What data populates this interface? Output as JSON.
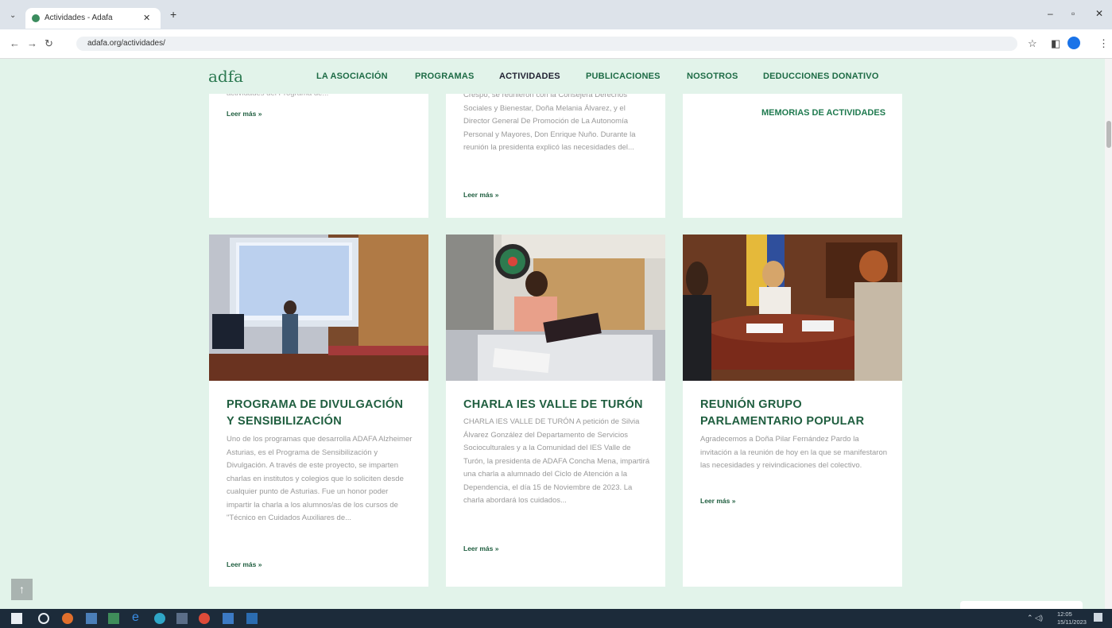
{
  "browser": {
    "tab_title": "Actividades - Adafa",
    "tab_close": "✕",
    "new_tab": "+",
    "url": "adafa.org/actividades/",
    "window_controls": [
      "–",
      "▫",
      "✕"
    ]
  },
  "site": {
    "logo": "adfa",
    "menu": [
      {
        "label": "LA ASOCIACIÓN"
      },
      {
        "label": "PROGRAMAS"
      },
      {
        "label": "ACTIVIDADES"
      },
      {
        "label": "PUBLICACIONES"
      },
      {
        "label": "NOSOTROS"
      },
      {
        "label": "DEDUCCIONES DONATIVO"
      }
    ],
    "active_menu": "ACTIVIDADES",
    "memorias_link": "MEMORIAS DE ACTIVIDADES"
  },
  "top_cards": [
    {
      "desc": "actividades del Programa de...",
      "more": "Leer más »"
    },
    {
      "desc": "Crespo, se reunieron con la Consejera Derechos Sociales y Bienestar, Doña Melania Álvarez, y el Director General De Promoción de La Autonomía Personal y Mayores, Don Enrique Nuño. Durante la reunión la presidenta explicó las necesidades del...",
      "more": "Leer más »"
    }
  ],
  "cards": [
    {
      "title_lines": [
        "PROGRAMA DE DIVULGACIÓN",
        "Y SENSIBILIZACIÓN"
      ],
      "desc": "Uno de los programas que desarrolla ADAFA Alzheimer Asturias, es el Programa de Sensibilización y Divulgación. A través de este proyecto, se imparten charlas en institutos y colegios que lo soliciten desde cualquier punto de Asturias. Fue un honor poder impartir la charla a los alumnos/as de los cursos de \"Técnico en Cuidados Auxiliares de...",
      "more": "Leer más »"
    },
    {
      "title_lines": [
        "CHARLA IES VALLE DE TURÓN"
      ],
      "desc": "CHARLA IES VALLE DE TURÓN A petición de Silvia Álvarez González del Departamento de Servicios Socioculturales y a la Comunidad del IES Valle de Turón, la presidenta de ADAFA Concha Mena, impartirá una charla a alumnado del Ciclo de Atención a la Dependencia, el día 15 de Noviembre de 2023. La charla abordará los cuidados...",
      "more": "Leer más »"
    },
    {
      "title_lines": [
        "REUNIÓN GRUPO",
        "PARLAMENTARIO POPULAR"
      ],
      "desc": "Agradecemos a Doña Pilar Fernández Pardo la invitación a la reunión de hoy en la que se manifestaron las necesidades y reivindicaciones del colectivo.",
      "more": "Leer más »"
    }
  ],
  "ui": {
    "back_to_top": "↑"
  },
  "taskbar": {
    "time": "12:05",
    "date": "15/11/2023"
  },
  "colors": {
    "page_bg": "#e2f3ea",
    "brand_green": "#1f5e3f",
    "taskbar": "#1c2b3a"
  }
}
